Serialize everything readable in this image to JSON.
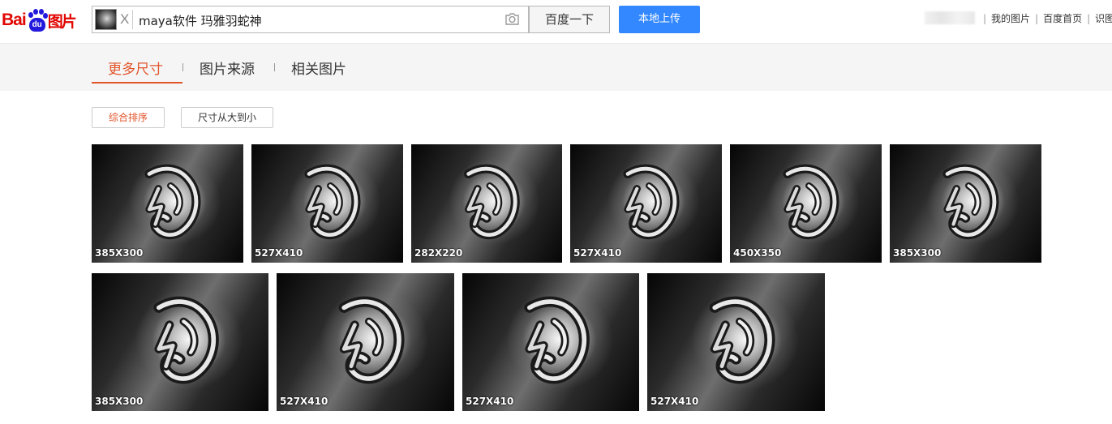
{
  "logo": {
    "bai": "Bai",
    "du": "du",
    "tupian": "图片"
  },
  "search": {
    "thumb_close": "X",
    "query": "maya软件 玛雅羽蛇神",
    "button_label": "百度一下",
    "upload_label": "本地上传"
  },
  "top_links": [
    "我的图片",
    "百度首页",
    "识图"
  ],
  "tabs": [
    "更多尺寸",
    "图片来源",
    "相关图片"
  ],
  "sort": {
    "default_label": "综合排序",
    "size_desc_label": "尺寸从大到小"
  },
  "results": [
    {
      "size": "385X300"
    },
    {
      "size": "527X410"
    },
    {
      "size": "282X220"
    },
    {
      "size": "527X410"
    },
    {
      "size": "450X350"
    },
    {
      "size": "385X300"
    },
    {
      "size": "385X300"
    },
    {
      "size": "527X410"
    },
    {
      "size": "527X410"
    },
    {
      "size": "527X410"
    }
  ],
  "colors": {
    "accent": "#e2542a",
    "upload_blue": "#3388ff",
    "logo_red": "#e10601",
    "logo_blue": "#2319dc"
  }
}
